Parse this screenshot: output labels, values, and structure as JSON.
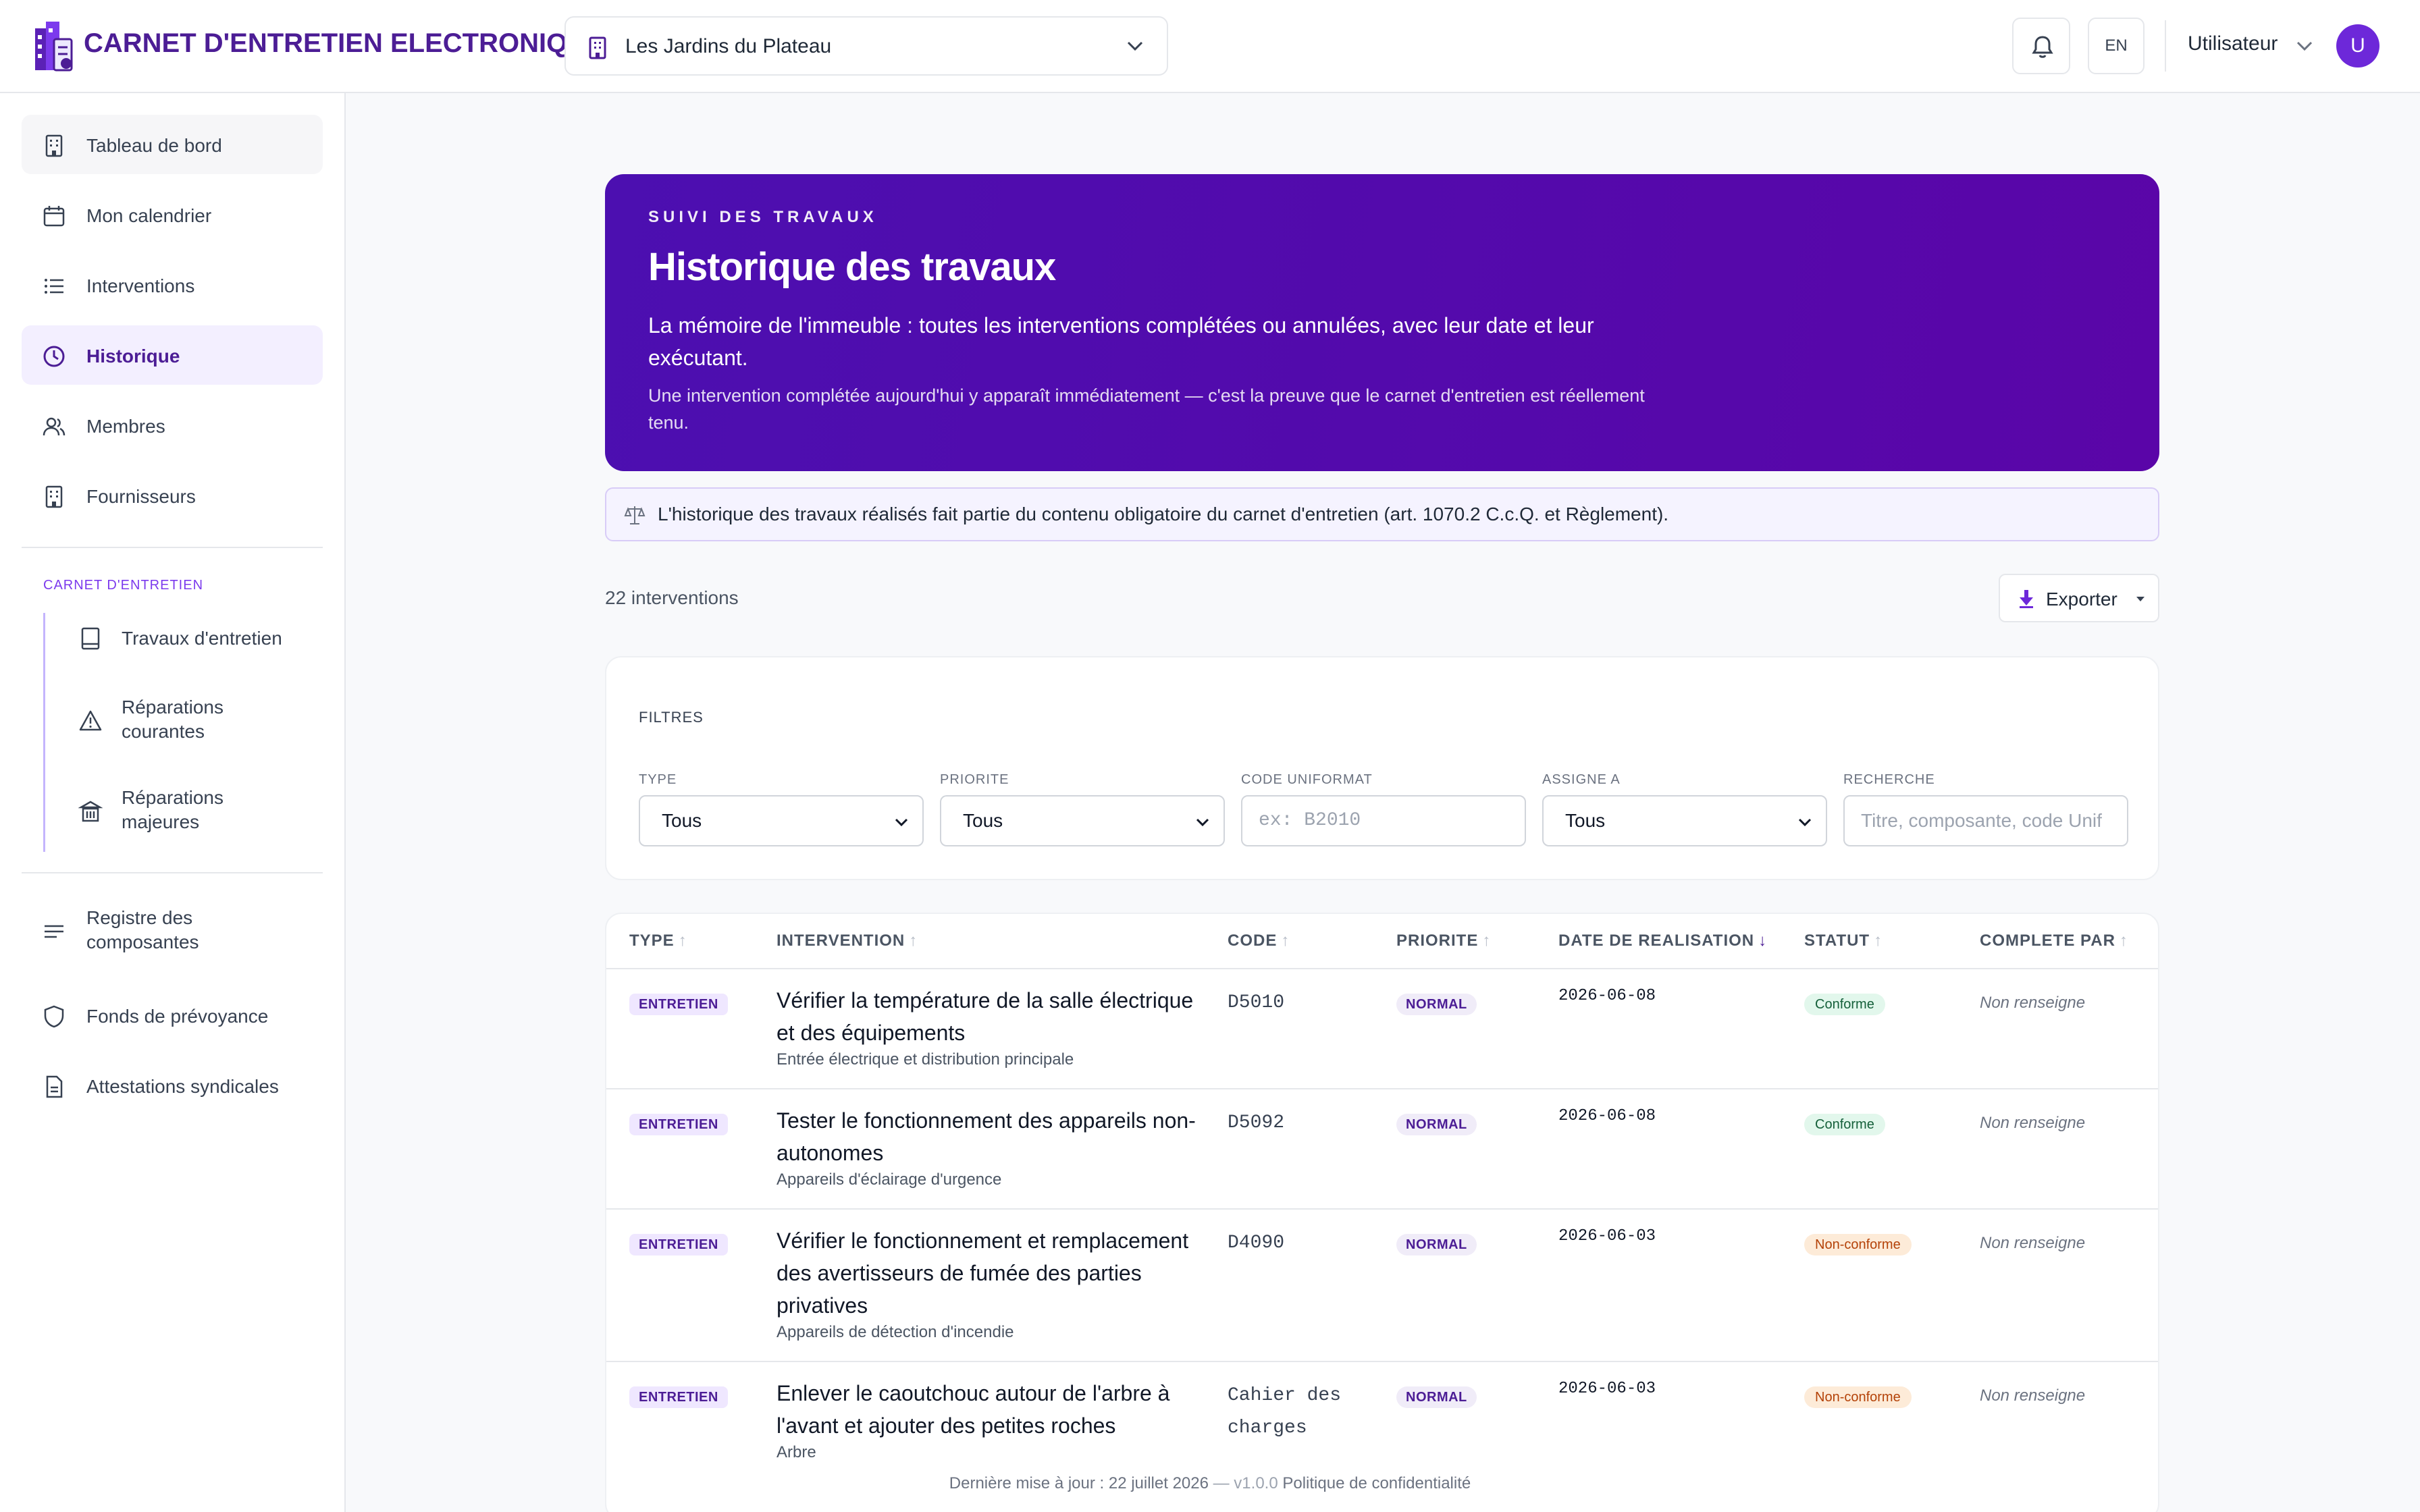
{
  "brand": {
    "title": "CARNET D'ENTRETIEN ELECTRONIQUE"
  },
  "building": {
    "selected": "Les Jardins du Plateau"
  },
  "header": {
    "lang": "EN",
    "user": "Utilisateur",
    "avatar_initial": "U"
  },
  "sidebar": {
    "items": [
      {
        "label": "Tableau de bord"
      },
      {
        "label": "Mon calendrier"
      },
      {
        "label": "Interventions"
      },
      {
        "label": "Historique"
      },
      {
        "label": "Membres"
      },
      {
        "label": "Fournisseurs"
      }
    ],
    "group_title": "CARNET D'ENTRETIEN",
    "group_items": [
      {
        "label": "Travaux d'entretien"
      },
      {
        "label": "Réparations courantes"
      },
      {
        "label": "Réparations majeures"
      }
    ],
    "bottom_items": [
      {
        "label": "Registre des composantes"
      },
      {
        "label": "Fonds de prévoyance"
      },
      {
        "label": "Attestations syndicales"
      }
    ]
  },
  "hero": {
    "eyebrow": "SUIVI DES TRAVAUX",
    "title": "Historique des travaux",
    "lead": "La mémoire de l'immeuble : toutes les interventions complétées ou annulées, avec leur date et leur exécutant.",
    "sub": "Une intervention complétée aujourd'hui y apparaît immédiatement — c'est la preuve que le carnet d'entretien est réellement tenu."
  },
  "notice": "L'historique des travaux réalisés fait partie du contenu obligatoire du carnet d'entretien (art. 1070.2 C.c.Q. et Règlement).",
  "summary": {
    "count": "22 interventions",
    "export_label": "Exporter"
  },
  "filters": {
    "title": "FILTRES",
    "type": {
      "label": "TYPE",
      "value": "Tous"
    },
    "priorite": {
      "label": "PRIORITE",
      "value": "Tous"
    },
    "code": {
      "label": "CODE UNIFORMAT",
      "placeholder": "ex: B2010"
    },
    "assigne": {
      "label": "ASSIGNE A",
      "value": "Tous"
    },
    "recherche": {
      "label": "RECHERCHE",
      "placeholder": "Titre, composante, code Unif"
    }
  },
  "table": {
    "columns": [
      "TYPE",
      "INTERVENTION",
      "CODE",
      "PRIORITE",
      "DATE DE REALISATION",
      "STATUT",
      "COMPLETE PAR"
    ],
    "rows": [
      {
        "type": "ENTRETIEN",
        "title": "Vérifier la température de la salle électrique et des équipements",
        "component": "Entrée électrique et distribution principale",
        "code": "D5010",
        "priority": "NORMAL",
        "date": "2026-06-08",
        "status": "Conforme",
        "by": "Non renseigne"
      },
      {
        "type": "ENTRETIEN",
        "title": "Tester le fonctionnement des appareils non-autonomes",
        "component": "Appareils d'éclairage d'urgence",
        "code": "D5092",
        "priority": "NORMAL",
        "date": "2026-06-08",
        "status": "Conforme",
        "by": "Non renseigne"
      },
      {
        "type": "ENTRETIEN",
        "title": "Vérifier le fonctionnement et remplacement des avertisseurs de fumée des parties privatives",
        "component": "Appareils de détection d'incendie",
        "code": "D4090",
        "priority": "NORMAL",
        "date": "2026-06-03",
        "status": "Non-conforme",
        "by": "Non renseigne"
      },
      {
        "type": "ENTRETIEN",
        "title": "Enlever le caoutchouc autour de l'arbre à l'avant et ajouter des petites roches",
        "component": "Arbre",
        "code": "Cahier des charges",
        "priority": "NORMAL",
        "date": "2026-06-03",
        "status": "Non-conforme",
        "by": "Non renseigne"
      }
    ]
  },
  "footer": {
    "updated": "Dernière mise à jour : 22 juillet 2026",
    "version": "— v1.0.0",
    "privacy": "Politique de confidentialité"
  },
  "colors": {
    "brand": "#4c1d95",
    "hero": "#5007ad",
    "accent": "#7c3aed",
    "ok": "#15603a",
    "ko": "#b44208"
  }
}
